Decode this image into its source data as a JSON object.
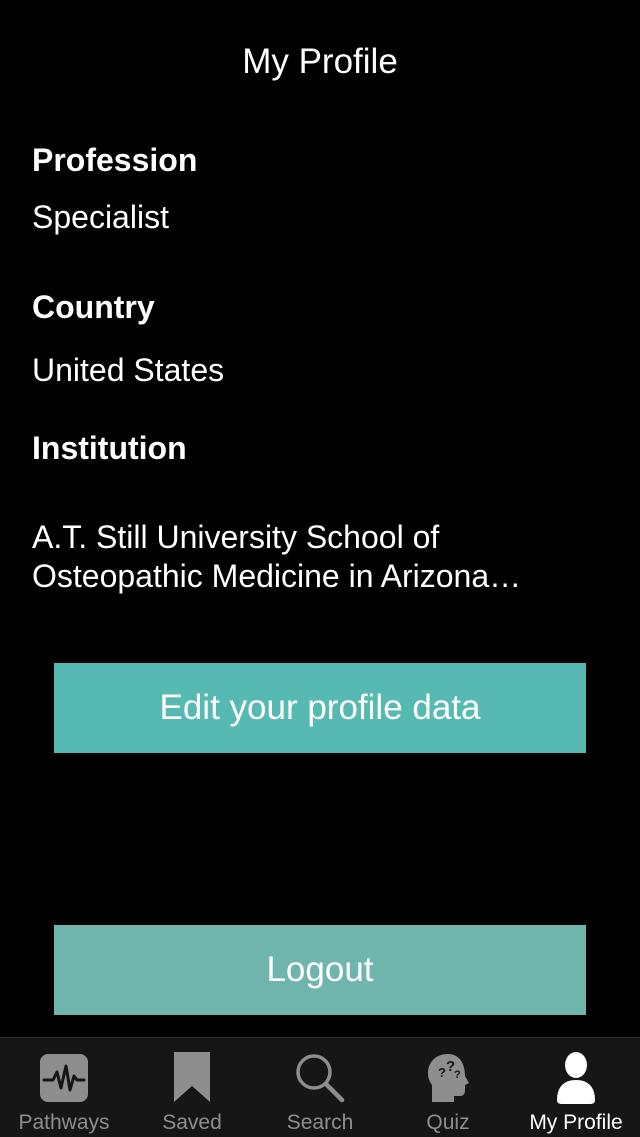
{
  "header": {
    "title": "My Profile"
  },
  "profile": {
    "profession_label": "Profession",
    "profession_value": "Specialist",
    "country_label": "Country",
    "country_value": "United States",
    "institution_label": "Institution",
    "institution_value": "A.T. Still University School of Osteopathic Medicine in Arizona (SOMA)"
  },
  "actions": {
    "edit_label": "Edit your profile data",
    "logout_label": "Logout"
  },
  "tabbar": {
    "active": "My Profile",
    "tabs": [
      {
        "label": "Pathways",
        "icon": "pathways-icon"
      },
      {
        "label": "Saved",
        "icon": "bookmark-icon"
      },
      {
        "label": "Search",
        "icon": "search-icon"
      },
      {
        "label": "Quiz",
        "icon": "quiz-head-icon"
      },
      {
        "label": "My Profile",
        "icon": "person-icon"
      }
    ]
  },
  "colors": {
    "background": "#000000",
    "edit_button": "#56b9b2",
    "logout_button": "#70b5ad",
    "tabbar_background": "#161616",
    "tab_inactive": "#8e8e8e",
    "tab_active": "#ffffff"
  }
}
